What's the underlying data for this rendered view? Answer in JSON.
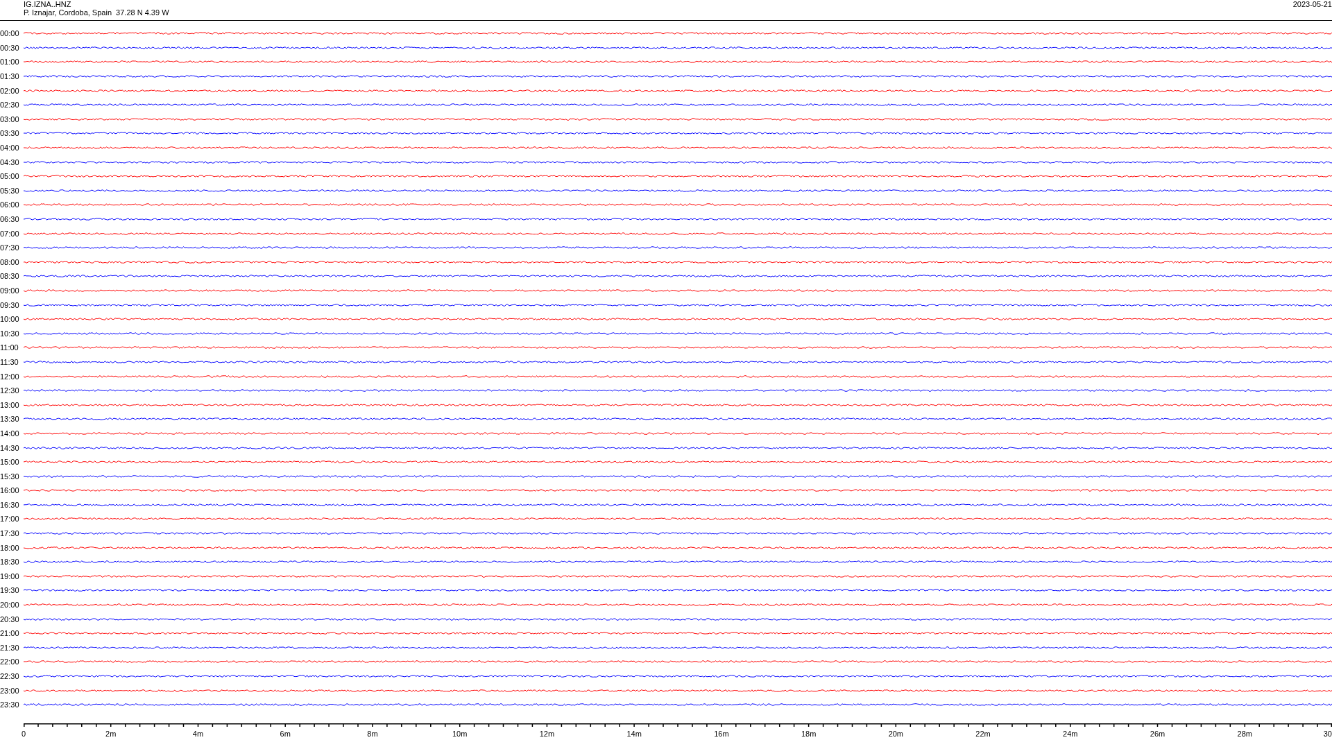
{
  "header": {
    "station": "IG.IZNA..HNZ",
    "location": "P. Iznajar, Cordoba, Spain  37.28 N 4.39 W",
    "date": "2023-05-21"
  },
  "rows": [
    {
      "time": "00:00",
      "color": "#ff0000"
    },
    {
      "time": "00:30",
      "color": "#0000ff"
    },
    {
      "time": "01:00",
      "color": "#ff0000"
    },
    {
      "time": "01:30",
      "color": "#0000ff"
    },
    {
      "time": "02:00",
      "color": "#ff0000"
    },
    {
      "time": "02:30",
      "color": "#0000ff"
    },
    {
      "time": "03:00",
      "color": "#ff0000"
    },
    {
      "time": "03:30",
      "color": "#0000ff"
    },
    {
      "time": "04:00",
      "color": "#ff0000"
    },
    {
      "time": "04:30",
      "color": "#0000ff"
    },
    {
      "time": "05:00",
      "color": "#ff0000"
    },
    {
      "time": "05:30",
      "color": "#0000ff"
    },
    {
      "time": "06:00",
      "color": "#ff0000"
    },
    {
      "time": "06:30",
      "color": "#0000ff"
    },
    {
      "time": "07:00",
      "color": "#ff0000"
    },
    {
      "time": "07:30",
      "color": "#0000ff"
    },
    {
      "time": "08:00",
      "color": "#ff0000"
    },
    {
      "time": "08:30",
      "color": "#0000ff"
    },
    {
      "time": "09:00",
      "color": "#ff0000"
    },
    {
      "time": "09:30",
      "color": "#0000ff"
    },
    {
      "time": "10:00",
      "color": "#ff0000"
    },
    {
      "time": "10:30",
      "color": "#0000ff"
    },
    {
      "time": "11:00",
      "color": "#ff0000"
    },
    {
      "time": "11:30",
      "color": "#0000ff"
    },
    {
      "time": "12:00",
      "color": "#ff0000"
    },
    {
      "time": "12:30",
      "color": "#0000ff"
    },
    {
      "time": "13:00",
      "color": "#ff0000"
    },
    {
      "time": "13:30",
      "color": "#0000ff"
    },
    {
      "time": "14:00",
      "color": "#ff0000"
    },
    {
      "time": "14:30",
      "color": "#0000ff"
    },
    {
      "time": "15:00",
      "color": "#ff0000"
    },
    {
      "time": "15:30",
      "color": "#0000ff"
    },
    {
      "time": "16:00",
      "color": "#ff0000"
    },
    {
      "time": "16:30",
      "color": "#0000ff"
    },
    {
      "time": "17:00",
      "color": "#ff0000"
    },
    {
      "time": "17:30",
      "color": "#0000ff"
    },
    {
      "time": "18:00",
      "color": "#ff0000"
    },
    {
      "time": "18:30",
      "color": "#0000ff"
    },
    {
      "time": "19:00",
      "color": "#ff0000"
    },
    {
      "time": "19:30",
      "color": "#0000ff"
    },
    {
      "time": "20:00",
      "color": "#ff0000"
    },
    {
      "time": "20:30",
      "color": "#0000ff"
    },
    {
      "time": "21:00",
      "color": "#ff0000"
    },
    {
      "time": "21:30",
      "color": "#0000ff"
    },
    {
      "time": "22:00",
      "color": "#ff0000"
    },
    {
      "time": "22:30",
      "color": "#0000ff"
    },
    {
      "time": "23:00",
      "color": "#ff0000"
    },
    {
      "time": "23:30",
      "color": "#0000ff"
    }
  ],
  "x_axis": {
    "labels": [
      "0",
      "2m",
      "4m",
      "6m",
      "8m",
      "10m",
      "12m",
      "14m",
      "16m",
      "18m",
      "20m",
      "22m",
      "24m",
      "26m",
      "28m",
      "30"
    ]
  }
}
